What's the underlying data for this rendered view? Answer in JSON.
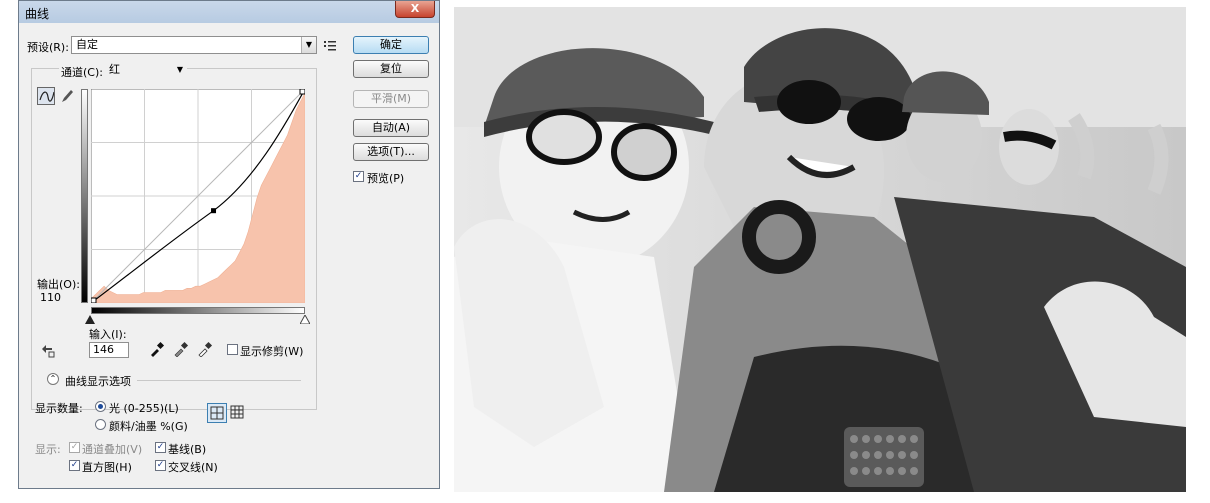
{
  "dialog": {
    "title": "曲线",
    "close_symbol": "X",
    "preset_label": "预设(R):",
    "preset_value": "自定",
    "channel_label": "通道(C):",
    "channel_value": "红",
    "output_label": "输出(O):",
    "output_value": "110",
    "input_label": "输入(I):",
    "input_value": "146",
    "show_clipping_label": "显示修剪(W)",
    "curve_display_options_label": "曲线显示选项",
    "show_amount_label": "显示数量:",
    "light_option": "光 (0-255)(L)",
    "pigment_option": "颜料/油墨 %(G)",
    "show_label": "显示:",
    "channel_overlay_label": "通道叠加(V)",
    "baseline_label": "基线(B)",
    "histogram_label": "直方图(H)",
    "intersection_label": "交叉线(N)",
    "buttons": {
      "ok": "确定",
      "reset": "复位",
      "smooth": "平滑(M)",
      "auto": "自动(A)",
      "options": "选项(T)..."
    },
    "preview_label": "预览(P)",
    "checkmark": "✓",
    "icons": [
      "curve-tool-icon",
      "pencil-icon",
      "preset-menu-icon",
      "target-adjust-icon",
      "black-eyedropper-icon",
      "gray-eyedropper-icon",
      "white-eyedropper-icon",
      "collapse-chevron-icon",
      "grid-4x4-icon",
      "grid-10x10-icon",
      "black-point-slider-icon",
      "white-point-slider-icon"
    ],
    "colors": {
      "histogram": "#f7c3ac",
      "curve": "#000000",
      "ok_button": "#b7dcf3",
      "close_button": "#c7432d"
    }
  },
  "curve": {
    "channel": "红",
    "points": [
      [
        0,
        0
      ],
      [
        146,
        110
      ],
      [
        255,
        255
      ]
    ],
    "selected_point": [
      146,
      110
    ],
    "histogram": [
      2,
      4,
      6,
      8,
      6,
      5,
      4,
      4,
      4,
      4,
      4,
      4,
      5,
      5,
      5,
      5,
      5,
      6,
      6,
      6,
      6,
      6,
      7,
      7,
      8,
      8,
      9,
      10,
      11,
      12,
      14,
      16,
      18,
      20,
      24,
      28,
      34,
      42,
      50,
      56,
      60,
      64,
      68,
      72,
      76,
      80,
      86,
      92,
      96,
      100
    ]
  },
  "photo": {
    "description_free": true
  }
}
